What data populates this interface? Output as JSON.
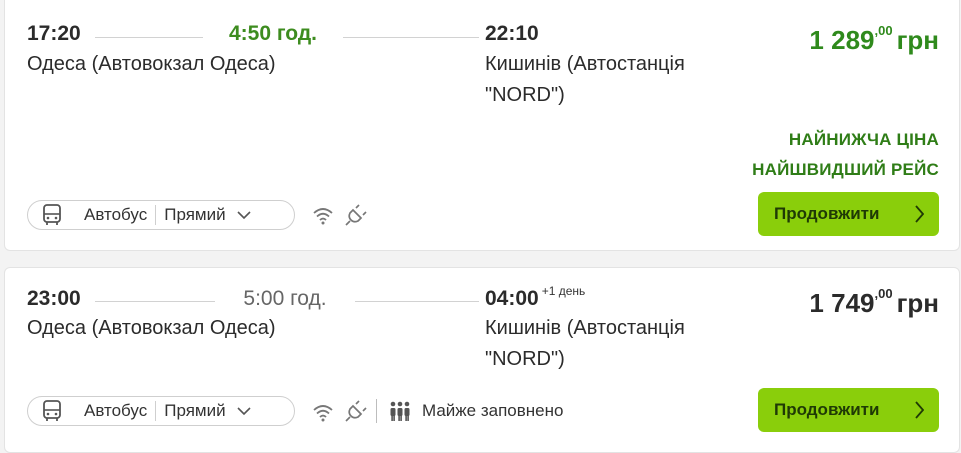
{
  "trips": [
    {
      "departure_time": "17:20",
      "duration": "4:50 год.",
      "arrival_time": "22:10",
      "arrival_note": "",
      "departure_station": "Одеса (Автовокзал Одеса)",
      "arrival_station": "Кишинів (Автостанція \"NORD\")",
      "price_main": "1 289",
      "price_cents": ",00",
      "currency": "грн",
      "tags": [
        "НАЙНИЖЧА ЦІНА",
        "НАЙШВИДШИЙ РЕЙС"
      ],
      "transport_type": "Автобус",
      "route_type": "Прямий",
      "amenities": [
        "wifi-icon",
        "power-plug-icon"
      ],
      "occupancy": "",
      "button_label": "Продовжити"
    },
    {
      "departure_time": "23:00",
      "duration": "5:00 год.",
      "arrival_time": "04:00",
      "arrival_note": "+1 день",
      "departure_station": "Одеса (Автовокзал Одеса)",
      "arrival_station": "Кишинів (Автостанція \"NORD\")",
      "price_main": "1 749",
      "price_cents": ",00",
      "currency": "грн",
      "tags": [],
      "transport_type": "Автобус",
      "route_type": "Прямий",
      "amenities": [
        "wifi-icon",
        "power-plug-icon",
        "people-icon"
      ],
      "occupancy": "Майже заповнено",
      "button_label": "Продовжити"
    }
  ],
  "colors": {
    "accent_green": "#8ace0b",
    "price_green": "#2f8a1c",
    "tag_green": "#2f7d17"
  }
}
